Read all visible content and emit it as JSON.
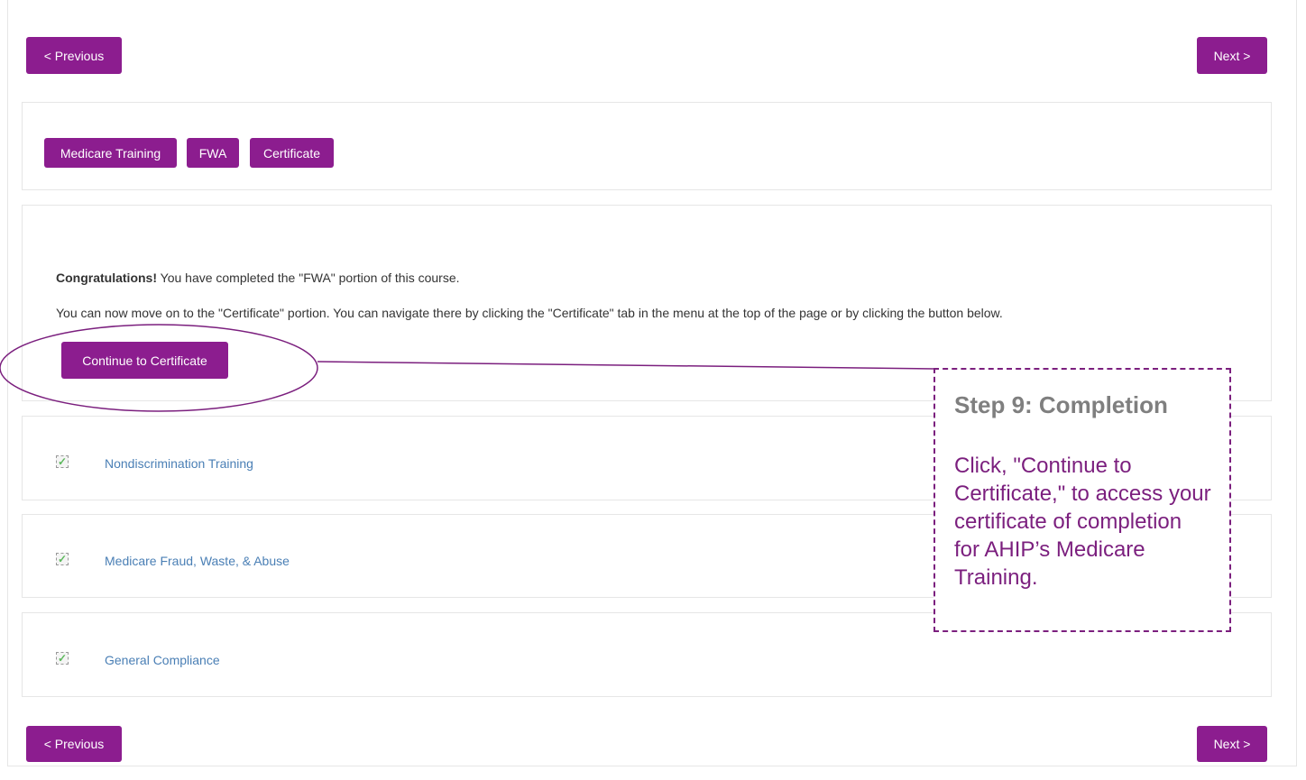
{
  "nav": {
    "prev_label": "< Previous",
    "next_label": "Next >"
  },
  "tabs": [
    {
      "label": "Medicare Training"
    },
    {
      "label": "FWA"
    },
    {
      "label": "Certificate"
    }
  ],
  "completion": {
    "congrats_strong": "Congratulations!",
    "congrats_rest": " You have completed the \"FWA\" portion of this course.",
    "instruction": "You can now move on to the \"Certificate\" portion. You can navigate there by clicking the \"Certificate\" tab in the menu at the top of the page or by clicking the button below.",
    "continue_label": "Continue to Certificate"
  },
  "modules": [
    {
      "label": "Nondiscrimination Training",
      "completed": true
    },
    {
      "label": "Medicare Fraud, Waste, & Abuse",
      "completed": true
    },
    {
      "label": "General Compliance",
      "completed": true
    }
  ],
  "callout": {
    "title": "Step 9: Completion",
    "body": "Click, \"Continue to Certificate,\" to access your certificate of completion for AHIP’s Medicare Training."
  },
  "colors": {
    "accent": "#8c1d8f",
    "callout_text": "#7b1f7e",
    "link": "#4a7fb5",
    "check": "#5cb85c"
  },
  "icons": {
    "check": "checkbox-checked-icon"
  }
}
